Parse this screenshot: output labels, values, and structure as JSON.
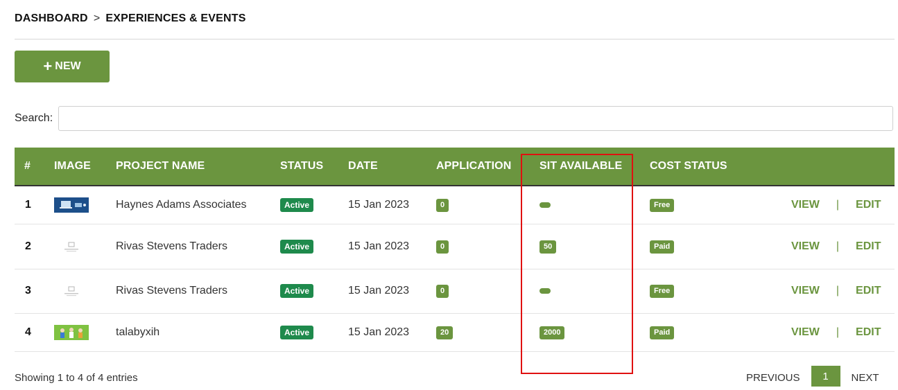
{
  "breadcrumb": {
    "root": "DASHBOARD",
    "separator": ">",
    "current": "EXPERIENCES & EVENTS"
  },
  "new_button": {
    "icon": "plus-icon",
    "label": "NEW"
  },
  "search": {
    "label": "Search:",
    "value": "",
    "placeholder": ""
  },
  "table": {
    "headers": [
      "#",
      "IMAGE",
      "PROJECT NAME",
      "STATUS",
      "DATE",
      "APPLICATION",
      "SIT AVAILABLE",
      "COST STATUS"
    ],
    "rows": [
      {
        "num": "1",
        "image": "event-thumbnail-laptop",
        "name": "Haynes Adams Associates",
        "status": "Active",
        "date": "15 Jan 2023",
        "application": "0",
        "sit_available": "",
        "cost_status": "Free",
        "view": "VIEW",
        "sep": "|",
        "edit": "EDIT"
      },
      {
        "num": "2",
        "image": "no-image-placeholder",
        "name": "Rivas Stevens Traders",
        "status": "Active",
        "date": "15 Jan 2023",
        "application": "0",
        "sit_available": "50",
        "cost_status": "Paid",
        "view": "VIEW",
        "sep": "|",
        "edit": "EDIT"
      },
      {
        "num": "3",
        "image": "no-image-placeholder",
        "name": "Rivas Stevens Traders",
        "status": "Active",
        "date": "15 Jan 2023",
        "application": "0",
        "sit_available": "",
        "cost_status": "Free",
        "view": "VIEW",
        "sep": "|",
        "edit": "EDIT"
      },
      {
        "num": "4",
        "image": "event-thumbnail-people",
        "name": "talabyxih",
        "status": "Active",
        "date": "15 Jan 2023",
        "application": "20",
        "sit_available": "2000",
        "cost_status": "Paid",
        "view": "VIEW",
        "sep": "|",
        "edit": "EDIT"
      }
    ]
  },
  "footer": {
    "info": "Showing 1 to 4 of 4 entries",
    "previous": "PREVIOUS",
    "page": "1",
    "next": "NEXT"
  },
  "colors": {
    "accent": "#6b953f",
    "active_badge": "#1e8a4c",
    "highlight": "#e01010"
  }
}
